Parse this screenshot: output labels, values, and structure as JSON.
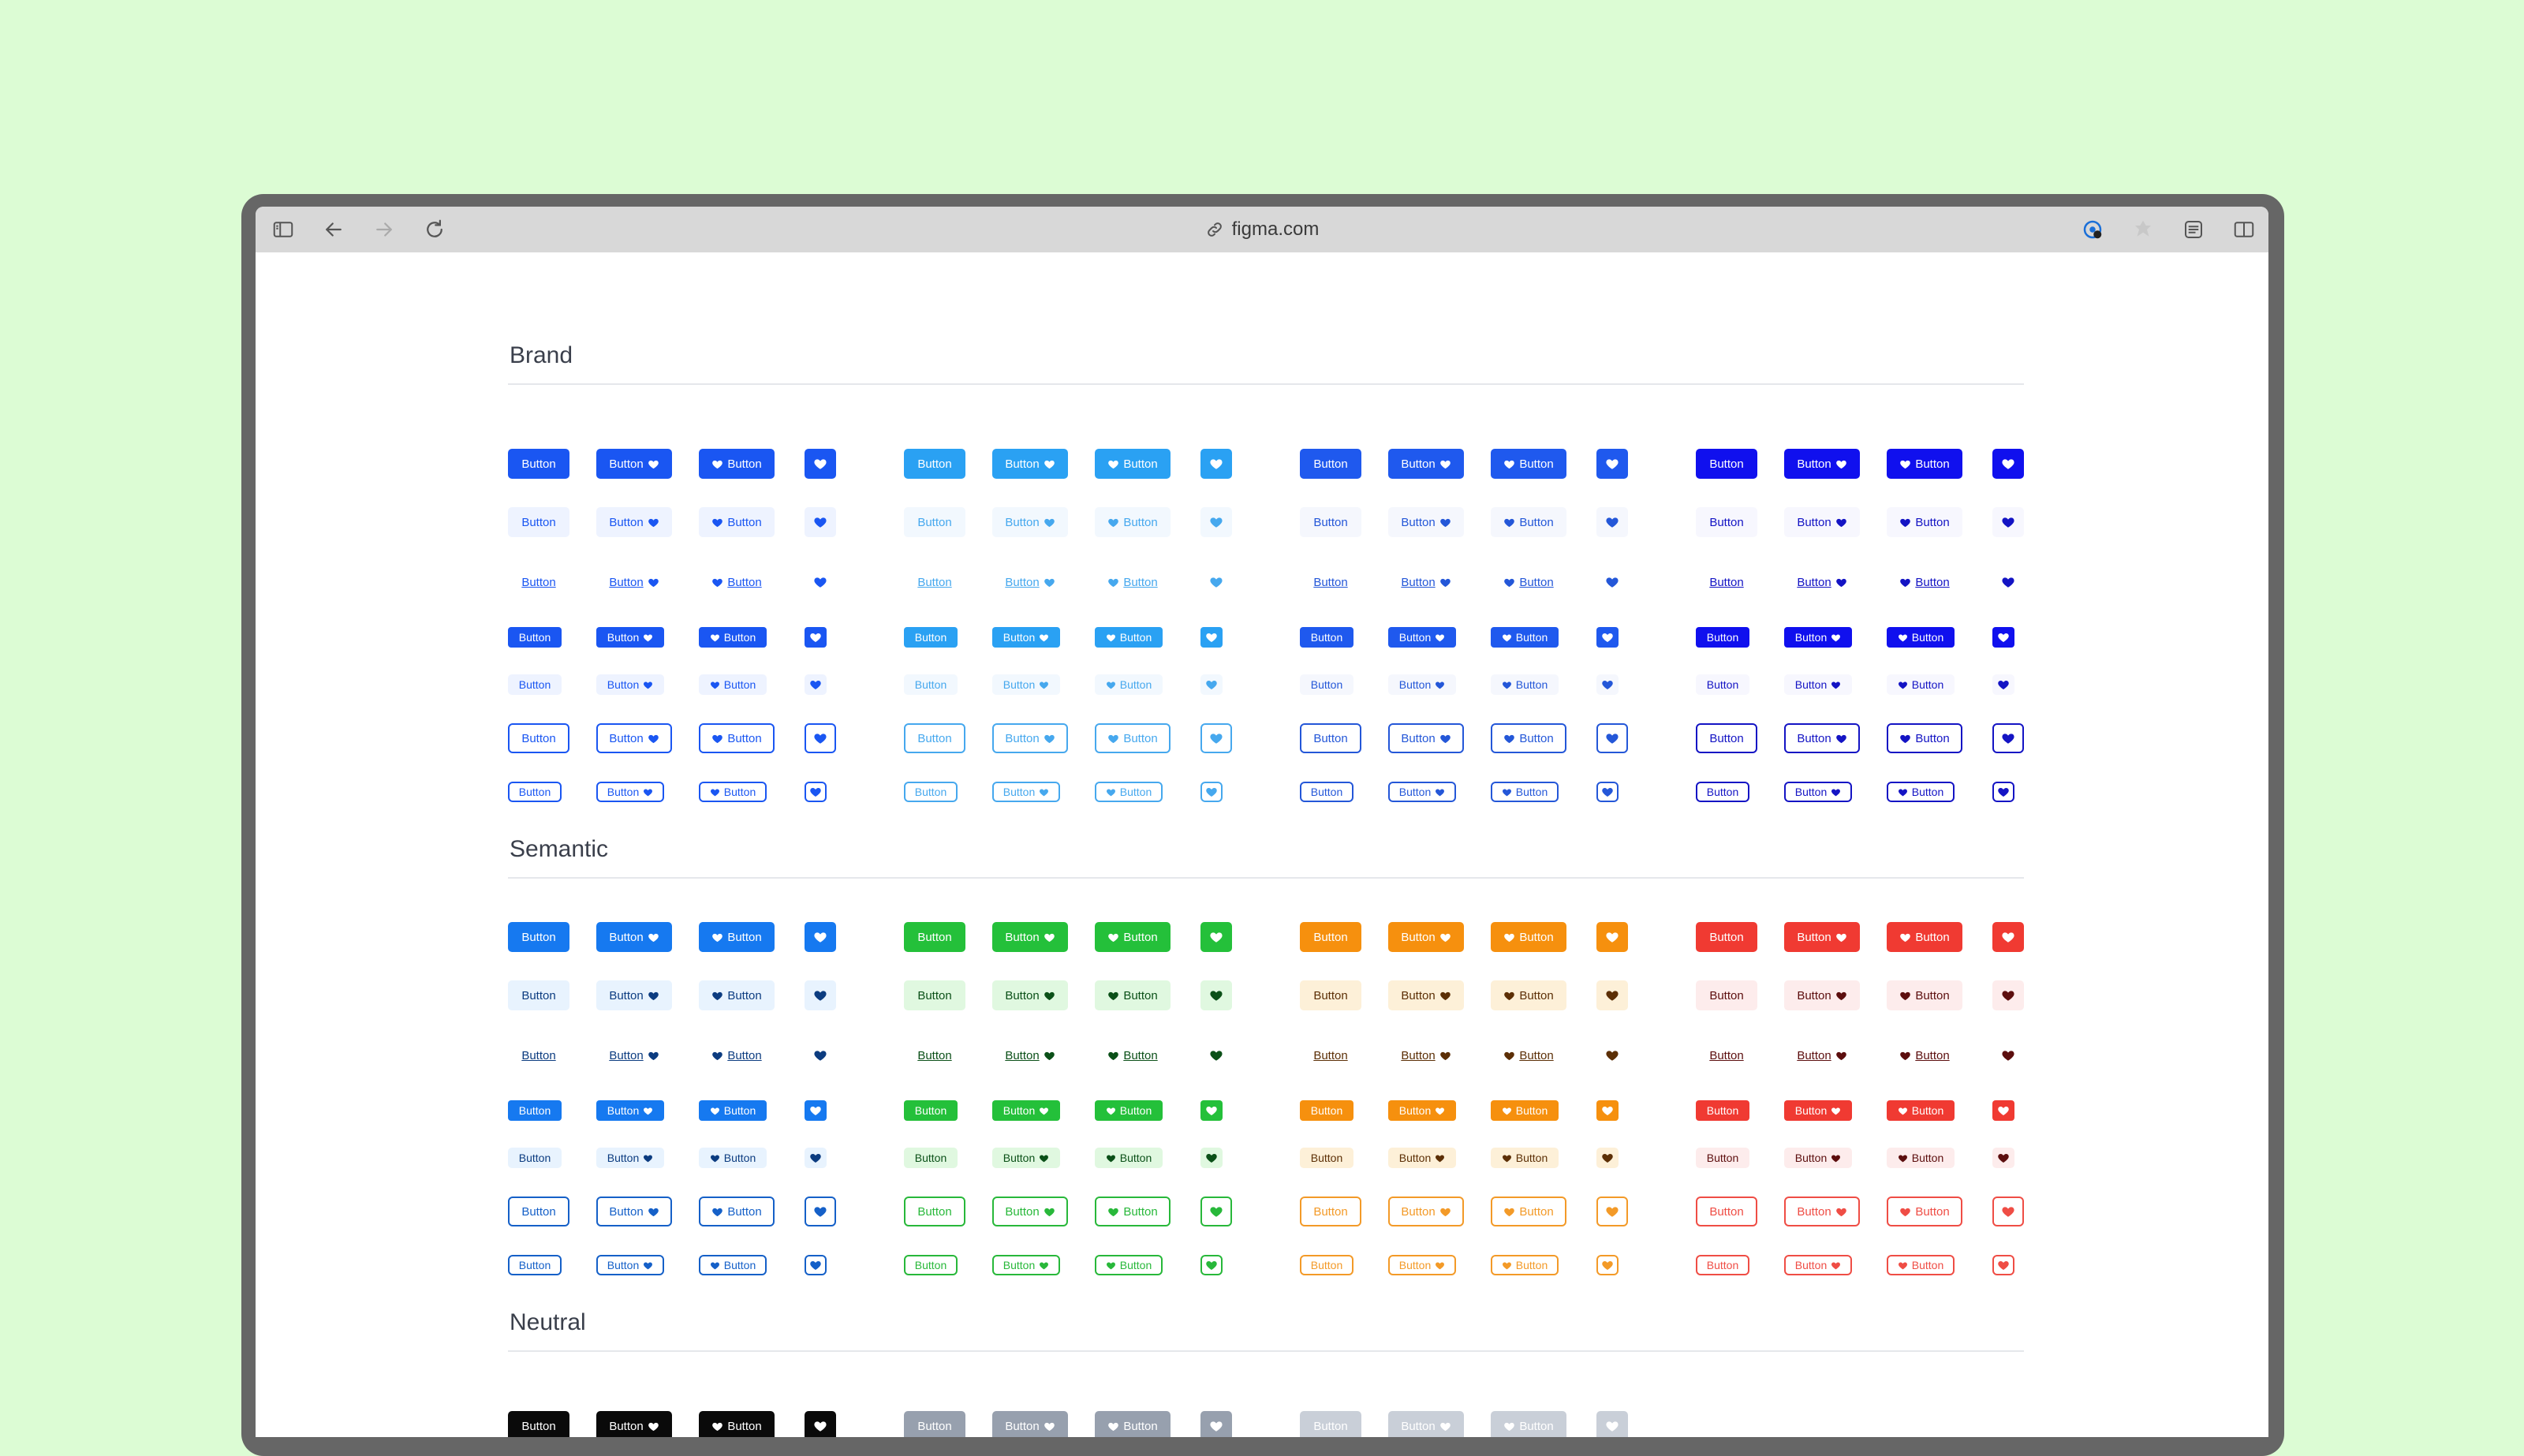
{
  "browser": {
    "url": "figma.com",
    "icons": [
      "sidebar-icon",
      "back-arrow-icon",
      "forward-arrow-icon",
      "reload-icon",
      "link-icon",
      "password-manager-icon",
      "extension-icon",
      "reader-settings-icon",
      "split-view-icon"
    ]
  },
  "button_label": "Button",
  "sections": [
    {
      "title": "Brand",
      "palettes": [
        {
          "solid": "#1a56f2",
          "soft": "#eef3ff",
          "fg": "#1a56f2"
        },
        {
          "solid": "#2aa1f3",
          "soft": "#f2f8fe",
          "fg": "#46a8ee"
        },
        {
          "solid": "#1f59ee",
          "soft": "#f5f7fd",
          "fg": "#2457d8"
        },
        {
          "solid": "#1010ee",
          "soft": "#f7f7fe",
          "fg": "#1414c4"
        }
      ]
    },
    {
      "title": "Semantic",
      "palettes": [
        {
          "solid": "#1679f0",
          "soft": "#e8f3fe",
          "fg": "#1560c8",
          "softfg": "#0c3c80"
        },
        {
          "solid": "#24c03a",
          "soft": "#e0f8e0",
          "fg": "#28b83a",
          "softfg": "#0b5018"
        },
        {
          "solid": "#f6900e",
          "soft": "#fdf0d8",
          "fg": "#f39a28",
          "softfg": "#5c2f06"
        },
        {
          "solid": "#f03a32",
          "soft": "#fdecec",
          "fg": "#ef4d45",
          "softfg": "#5c0e0e"
        }
      ]
    },
    {
      "title": "Neutral",
      "palettes": [
        {
          "solid": "#0a0a0a"
        },
        {
          "solid": "#97a0ae"
        },
        {
          "solid": "#c9cfd8"
        }
      ]
    }
  ]
}
